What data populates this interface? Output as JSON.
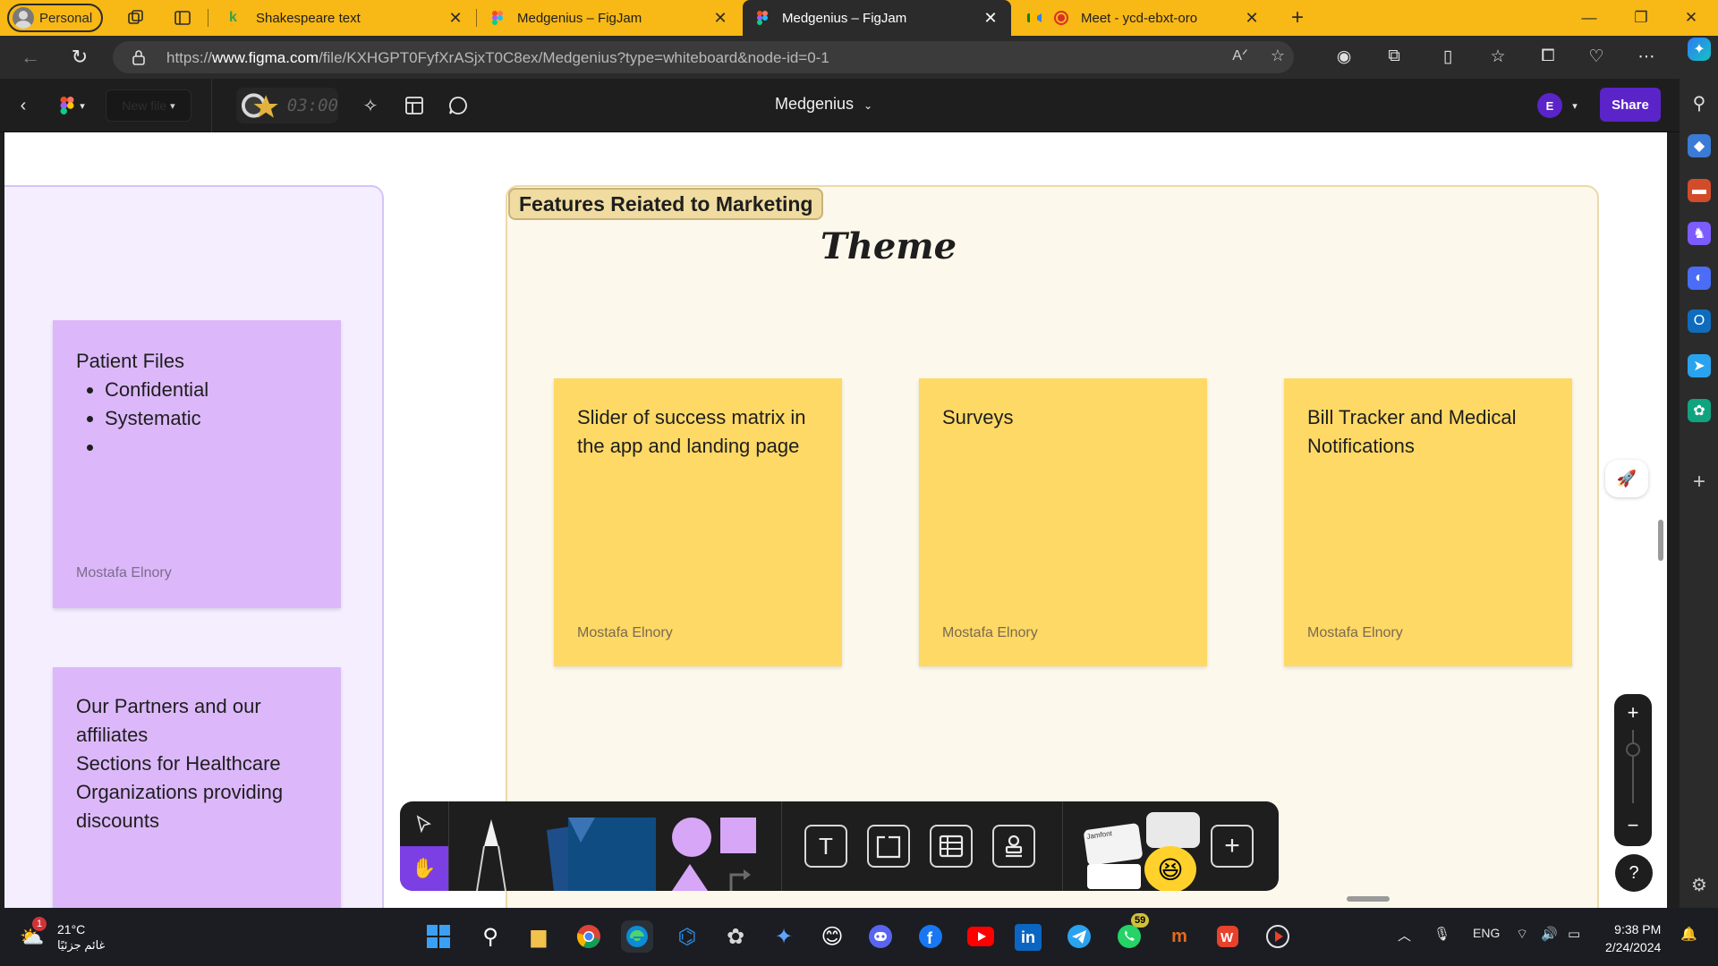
{
  "browser": {
    "profile_label": "Personal",
    "tabs": [
      {
        "title": "Shakespeare text",
        "active": false
      },
      {
        "title": "Medgenius – FigJam",
        "active": false
      },
      {
        "title": "Medgenius – FigJam",
        "active": true
      },
      {
        "title": "Meet - ycd-ebxt-oro",
        "active": false
      }
    ],
    "url_prefix": "https://",
    "url_domain": "www.figma.com",
    "url_path": "/file/KXHGPT0FyfXrASjxT0C8ex/Medgenius?type=whiteboard&node-id=0-1"
  },
  "figma": {
    "new_file_label": "New file",
    "timer": "03:00",
    "file_title": "Medgenius",
    "user_initial": "E",
    "share_label": "Share"
  },
  "canvas": {
    "left_stickies": [
      {
        "title": "Patient Files",
        "bullets": [
          "Confidential",
          "Systematic",
          ""
        ],
        "author": "Mostafa Elnory"
      },
      {
        "lines": [
          "Our Partners and our",
          "affiliates",
          "Sections for Healthcare",
          "Organizations providing",
          "discounts"
        ]
      }
    ],
    "section_title": "Features Reiated to Marketing",
    "theme_label": "Theme",
    "yellow_stickies": [
      {
        "text": "Slider of success matrix in the app and landing page",
        "author": "Mostafa Elnory"
      },
      {
        "text": "Surveys",
        "author": "Mostafa Elnory"
      },
      {
        "text": "Bill Tracker and Medical Notifications",
        "author": "Mostafa Elnory"
      }
    ],
    "stamp_sheet_label": "Jamfont"
  },
  "taskbar": {
    "temperature": "21°C",
    "weather_desc": "غائم جزئيًا",
    "weather_badge": "1",
    "whatsapp_badge": "59",
    "language": "ENG",
    "time": "9:38 PM",
    "date": "2/24/2024"
  },
  "colors": {
    "tab_strip": "#f8b815",
    "figma_purple": "#5b24c8",
    "sticky_yellow": "#ffd966",
    "sticky_purple": "#dcb8fa"
  }
}
